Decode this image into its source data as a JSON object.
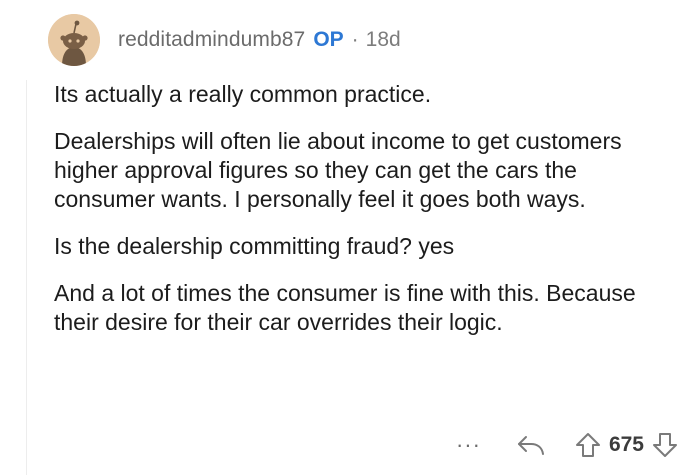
{
  "comment": {
    "author": "redditadmindumb87",
    "op_badge": "OP",
    "separator": "·",
    "age": "18d",
    "paragraphs": [
      "Its actually a really common practice.",
      "Dealerships will often lie about income to get customers higher approval figures so they can get the cars the consumer wants. I personally feel it goes both ways.",
      "Is the dealership committing fraud? yes",
      "And a lot of times the consumer is fine with this. Because their desire for their car overrides their logic."
    ],
    "actions": {
      "more_label": "···",
      "score": "675"
    }
  },
  "icons": {
    "avatar": "snoo-avatar-icon",
    "reply": "reply-arrow-icon",
    "upvote": "upvote-arrow-icon",
    "downvote": "downvote-arrow-icon"
  },
  "colors": {
    "op_badge": "#2d78d4",
    "username": "#6b6b6b",
    "avatar_bg": "#e8c9a4",
    "icon": "#7a7a7a"
  }
}
